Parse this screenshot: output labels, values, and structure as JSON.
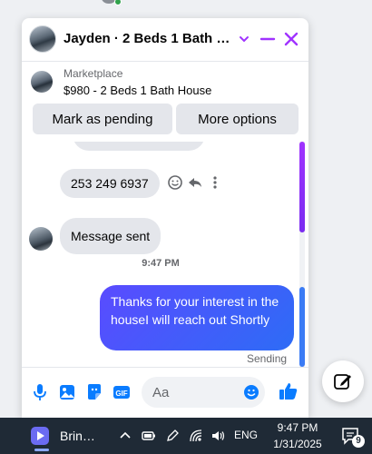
{
  "chat": {
    "title": "Jayden · 2 Beds 1 Bath Ho…",
    "marketplace_label": "Marketplace",
    "listing": "$980 - 2 Beds 1 Bath House",
    "actions": {
      "pending": "Mark as pending",
      "more": "More options"
    }
  },
  "messages": {
    "phone": "253 249 6937",
    "sent_note": "Message sent",
    "timestamp": "9:47 PM",
    "outgoing": "Thanks for your interest in the houseI will reach out Shortly",
    "status": "Sending"
  },
  "composer": {
    "placeholder": "Aa"
  },
  "taskbar": {
    "app_name": "Brin…",
    "language": "ENG",
    "time": "9:47 PM",
    "date": "1/31/2025",
    "notification_count": "9"
  },
  "colors": {
    "accent": "#a033ff",
    "brand_blue": "#0a7cff",
    "taskbar_bg": "#1f2a36"
  },
  "icons": [
    "minus-icon",
    "close-icon",
    "chevron-down-icon",
    "smile-icon",
    "reply-icon",
    "more-icon",
    "microphone-icon",
    "image-icon",
    "sticker-icon",
    "gif-icon",
    "emoji-icon",
    "thumbs-up-icon",
    "compose-icon",
    "chevron-up-icon",
    "wifi-icon",
    "volume-icon",
    "notification-icon"
  ]
}
